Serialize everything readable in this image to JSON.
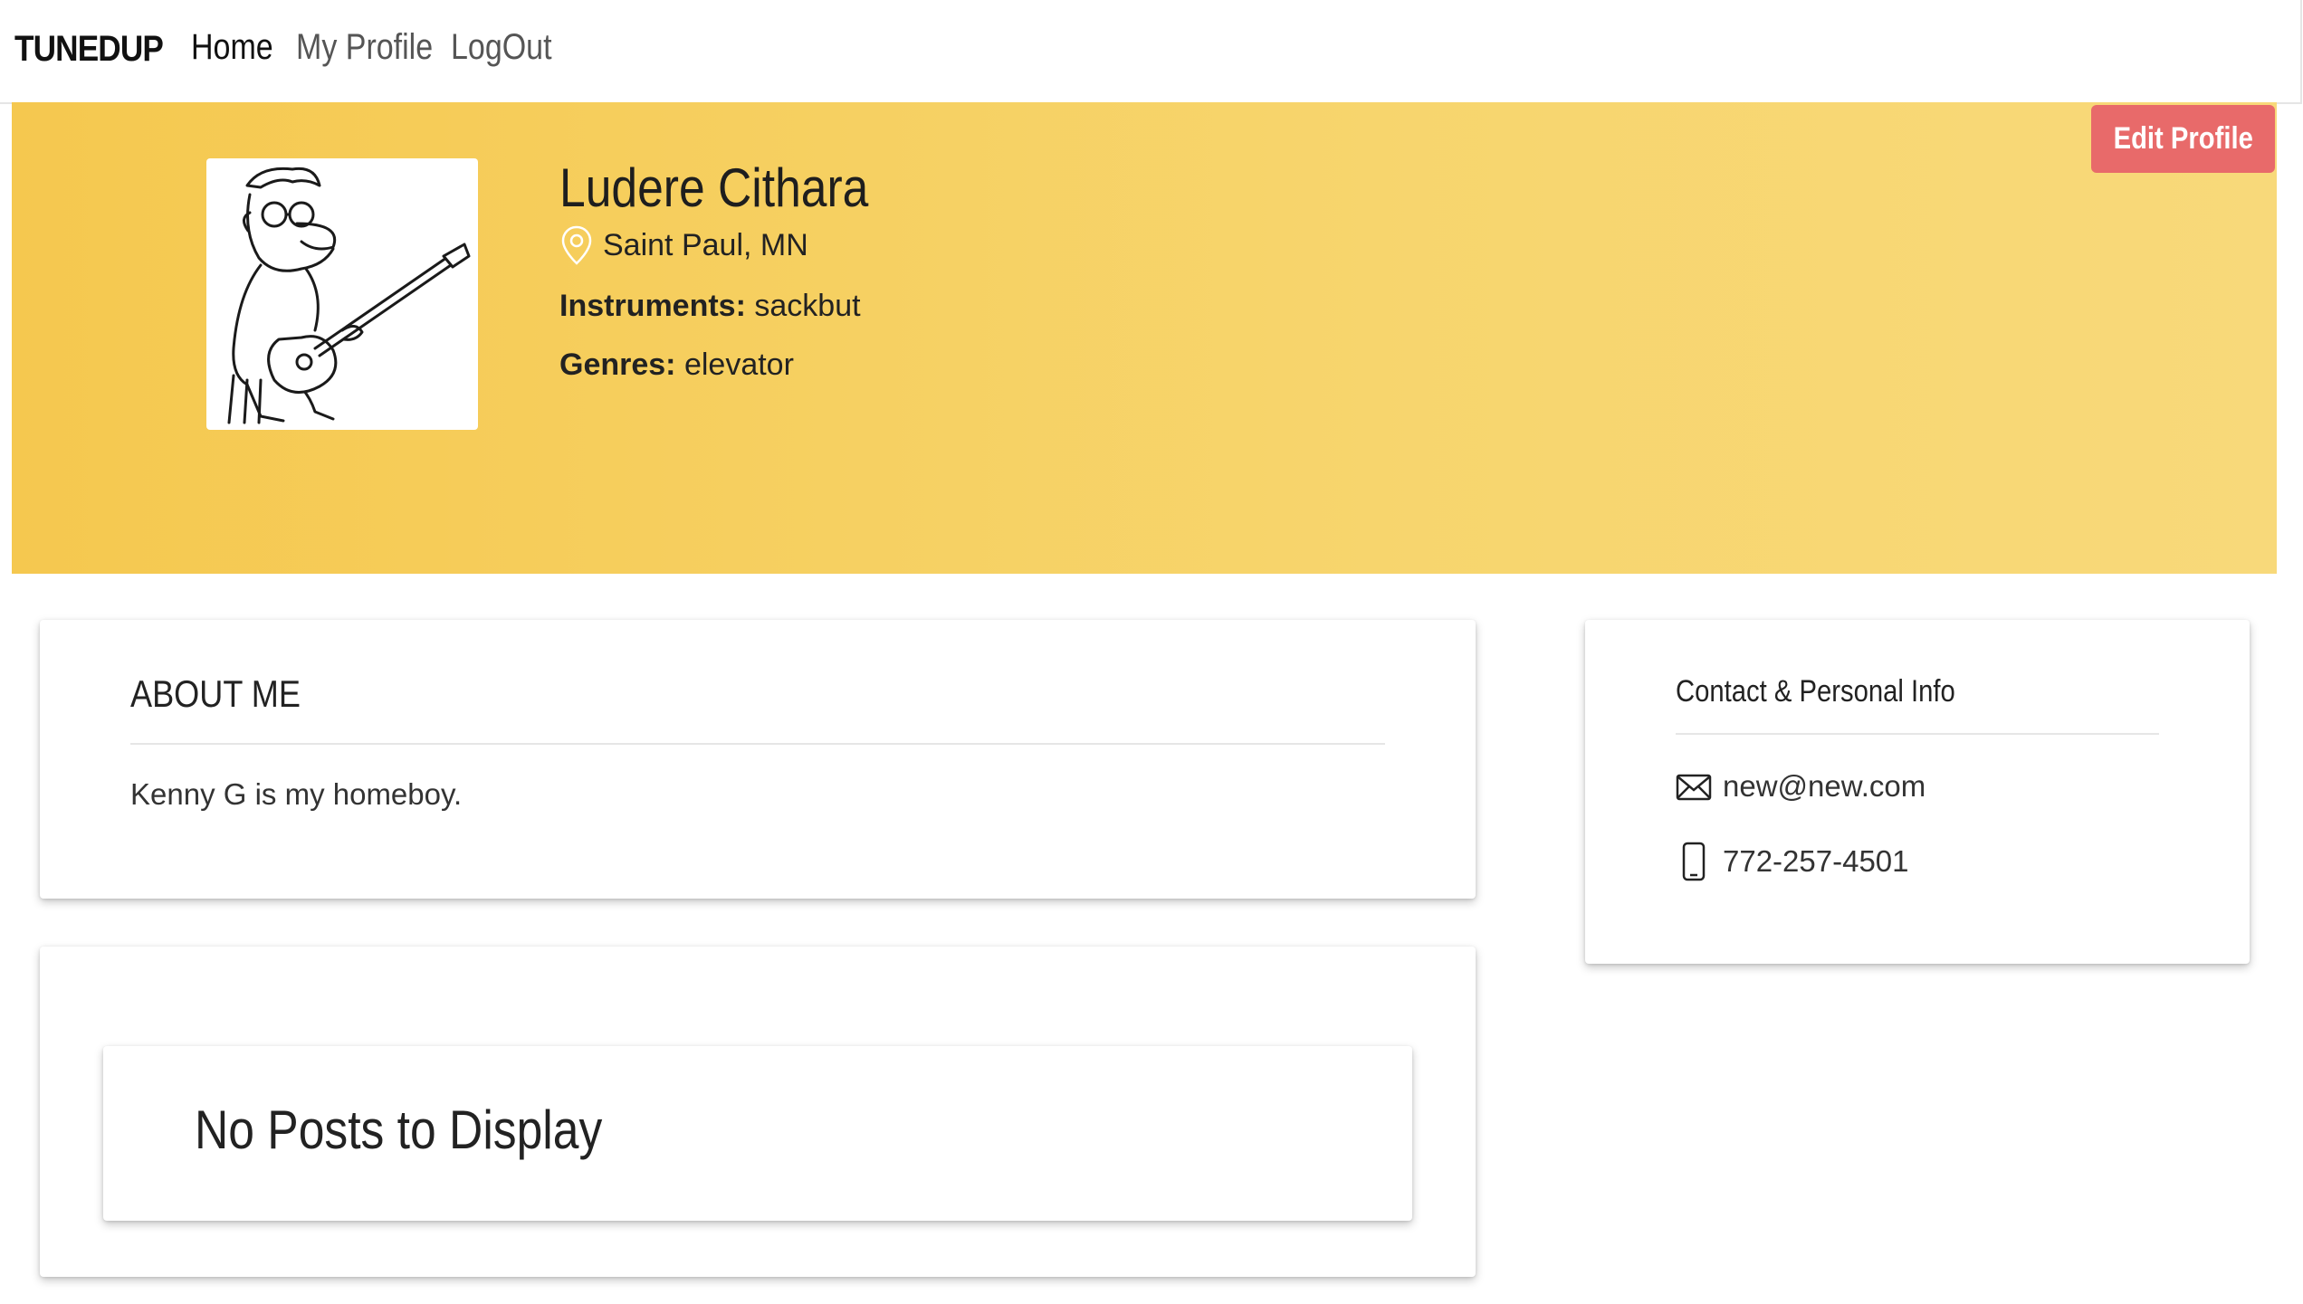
{
  "nav": {
    "brand": "TUNEDUP",
    "links": [
      {
        "label": "Home",
        "active": true
      },
      {
        "label": "My Profile",
        "active": false
      },
      {
        "label": "LogOut",
        "active": false
      }
    ]
  },
  "profile": {
    "name": "Ludere Cithara",
    "location": "Saint Paul, MN",
    "instruments_label": "Instruments:",
    "instruments": "sackbut",
    "genres_label": "Genres:",
    "genres": "elevator",
    "avatar_icon": "guitarist-cartoon-avatar",
    "edit_button": "Edit Profile"
  },
  "about": {
    "title": "ABOUT ME",
    "text": "Kenny G is my homeboy."
  },
  "contact": {
    "title": "Contact & Personal Info",
    "email": "new@new.com",
    "phone": "772-257-4501",
    "email_icon": "envelope-icon",
    "phone_icon": "phone-icon"
  },
  "posts": {
    "empty_message": "No Posts to Display"
  },
  "colors": {
    "banner_start": "#f5c84f",
    "banner_end": "#f8d97a",
    "edit_button": "#e86a6a"
  }
}
